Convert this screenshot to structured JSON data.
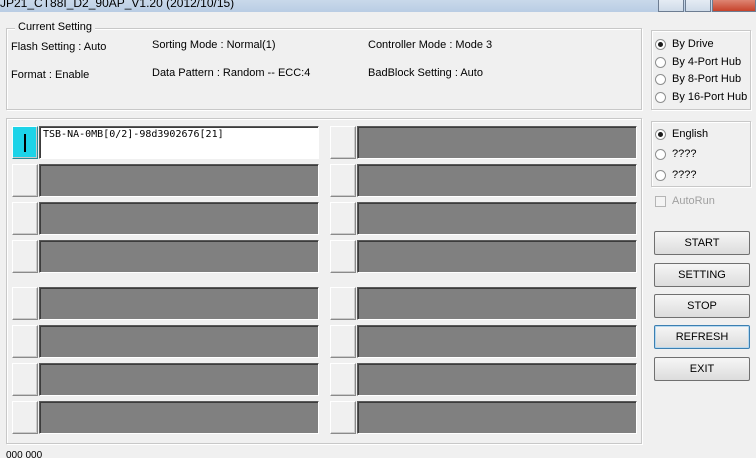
{
  "window": {
    "title": "JP21_CT88I_D2_90AP_V1.20 (2012/10/15)"
  },
  "current_setting": {
    "legend": "Current Setting",
    "flash_setting": "Flash Setting : Auto",
    "format": "Format : Enable",
    "sorting_mode": "Sorting Mode : Normal(1)",
    "data_pattern": "Data Pattern : Random -- ECC:4",
    "controller_mode": "Controller Mode : Mode 3",
    "badblock_setting": "BadBlock Setting : Auto"
  },
  "slots": [
    {
      "text": "TSB-NA-0MB[0/2]-98d3902676[21]",
      "active": true
    },
    {
      "text": "",
      "active": false
    },
    {
      "text": "",
      "active": false
    },
    {
      "text": "",
      "active": false
    },
    {
      "text": "",
      "active": false
    },
    {
      "text": "",
      "active": false
    },
    {
      "text": "",
      "active": false
    },
    {
      "text": "",
      "active": false
    },
    {
      "text": "",
      "active": false
    },
    {
      "text": "",
      "active": false
    },
    {
      "text": "",
      "active": false
    },
    {
      "text": "",
      "active": false
    },
    {
      "text": "",
      "active": false
    },
    {
      "text": "",
      "active": false
    },
    {
      "text": "",
      "active": false
    },
    {
      "text": "",
      "active": false
    }
  ],
  "drive_mode": {
    "options": [
      "By Drive",
      "By 4-Port Hub",
      "By 8-Port Hub",
      "By 16-Port Hub"
    ],
    "selected": "By Drive"
  },
  "language": {
    "options": [
      "English",
      "????",
      "????"
    ],
    "selected": "English"
  },
  "autorun": {
    "label": "AutoRun",
    "checked": false,
    "enabled": false
  },
  "buttons": {
    "start": "START",
    "setting": "SETTING",
    "stop": "STOP",
    "refresh": "REFRESH",
    "exit": "EXIT"
  },
  "status": {
    "text": "000 000"
  },
  "colors": {
    "active_slot": "#1cd3e8",
    "empty_slot": "#808080"
  }
}
